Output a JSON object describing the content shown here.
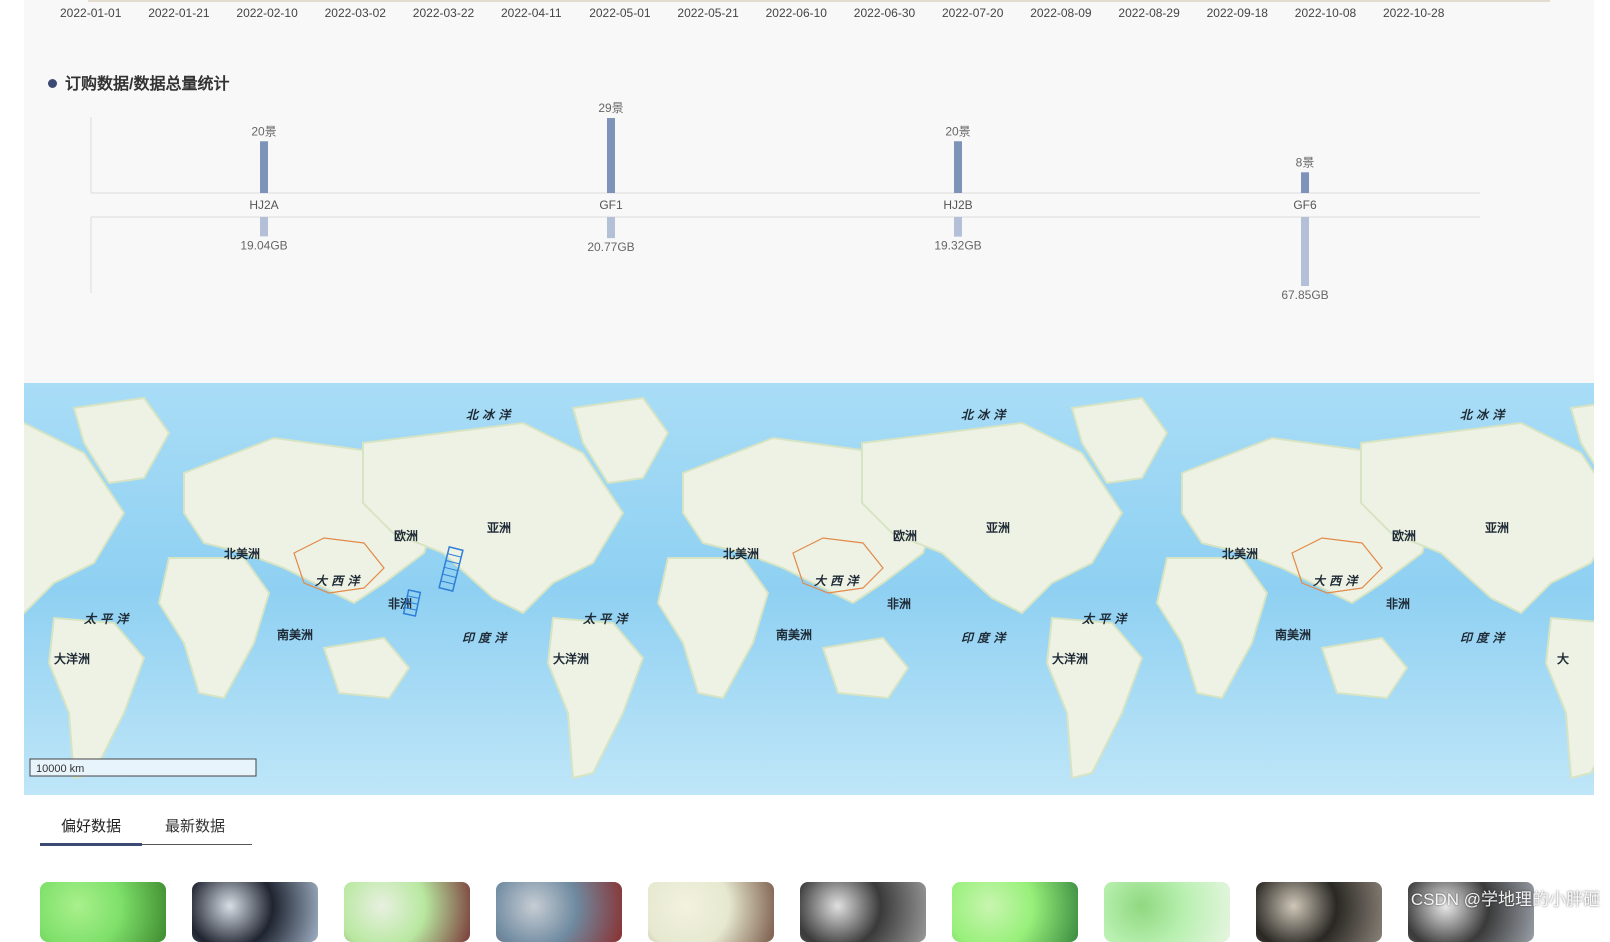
{
  "timeline": {
    "ticks": [
      "2022-01-01",
      "2022-01-21",
      "2022-02-10",
      "2022-03-02",
      "2022-03-22",
      "2022-04-11",
      "2022-05-01",
      "2022-05-21",
      "2022-06-10",
      "2022-06-30",
      "2022-07-20",
      "2022-08-09",
      "2022-08-29",
      "2022-09-18",
      "2022-10-08",
      "2022-10-28"
    ]
  },
  "stats": {
    "title": "订购数据/数据总量统计"
  },
  "chart_data": {
    "type": "bar",
    "title": "订购数据/数据总量统计",
    "categories": [
      "HJ2A",
      "GF1",
      "HJ2B",
      "GF6"
    ],
    "series": [
      {
        "values": [
          20,
          29,
          20,
          8
        ],
        "labels": [
          "20景",
          "29景",
          "20景",
          "8景"
        ],
        "color": "#7d93b8"
      },
      {
        "values": [
          19.04,
          20.77,
          19.32,
          67.85
        ],
        "labels": [
          "19.04GB",
          "20.77GB",
          "19.32GB",
          "67.85GB"
        ],
        "color": "#b3c0d8"
      }
    ]
  },
  "map": {
    "labels": {
      "arctic": "北 冰 洋",
      "europe": "欧洲",
      "asia": "亚洲",
      "north_america": "北美洲",
      "south_america": "南美洲",
      "africa": "非洲",
      "oceania": "大洋洲",
      "atlantic": "大 西 洋",
      "pacific": "太 平 洋",
      "indian": "印 度 洋",
      "oceania_cut": "大"
    },
    "scale": "10000 km"
  },
  "tabs": [
    {
      "label": "偏好数据",
      "active": true
    },
    {
      "label": "最新数据",
      "active": false
    }
  ],
  "thumbnails": [
    {
      "colors": [
        "#7ee06a",
        "#3f8a2f",
        "#a9f08c"
      ]
    },
    {
      "colors": [
        "#1f2430",
        "#9fb0c4",
        "#d8dee6"
      ]
    },
    {
      "colors": [
        "#b8e8a0",
        "#7a3a3a",
        "#e8f0e0"
      ]
    },
    {
      "colors": [
        "#6f8aa0",
        "#8a3030",
        "#c6cdd4"
      ]
    },
    {
      "colors": [
        "#e6e8cf",
        "#7a5a4a",
        "#f2f2e0"
      ]
    },
    {
      "colors": [
        "#3a3a3a",
        "#9a9a9a",
        "#e0e0e0"
      ]
    },
    {
      "colors": [
        "#98f07a",
        "#3a8a40",
        "#c8f5b0"
      ]
    },
    {
      "colors": [
        "#b8f0b0",
        "#e6f5e0",
        "#90d880"
      ]
    },
    {
      "colors": [
        "#2a2824",
        "#8a8278",
        "#cfc7b8"
      ]
    },
    {
      "colors": [
        "#3a3a3a",
        "#9aa0a8",
        "#e8e8e8"
      ]
    }
  ],
  "watermark": "CSDN @学地理的小胖砸"
}
